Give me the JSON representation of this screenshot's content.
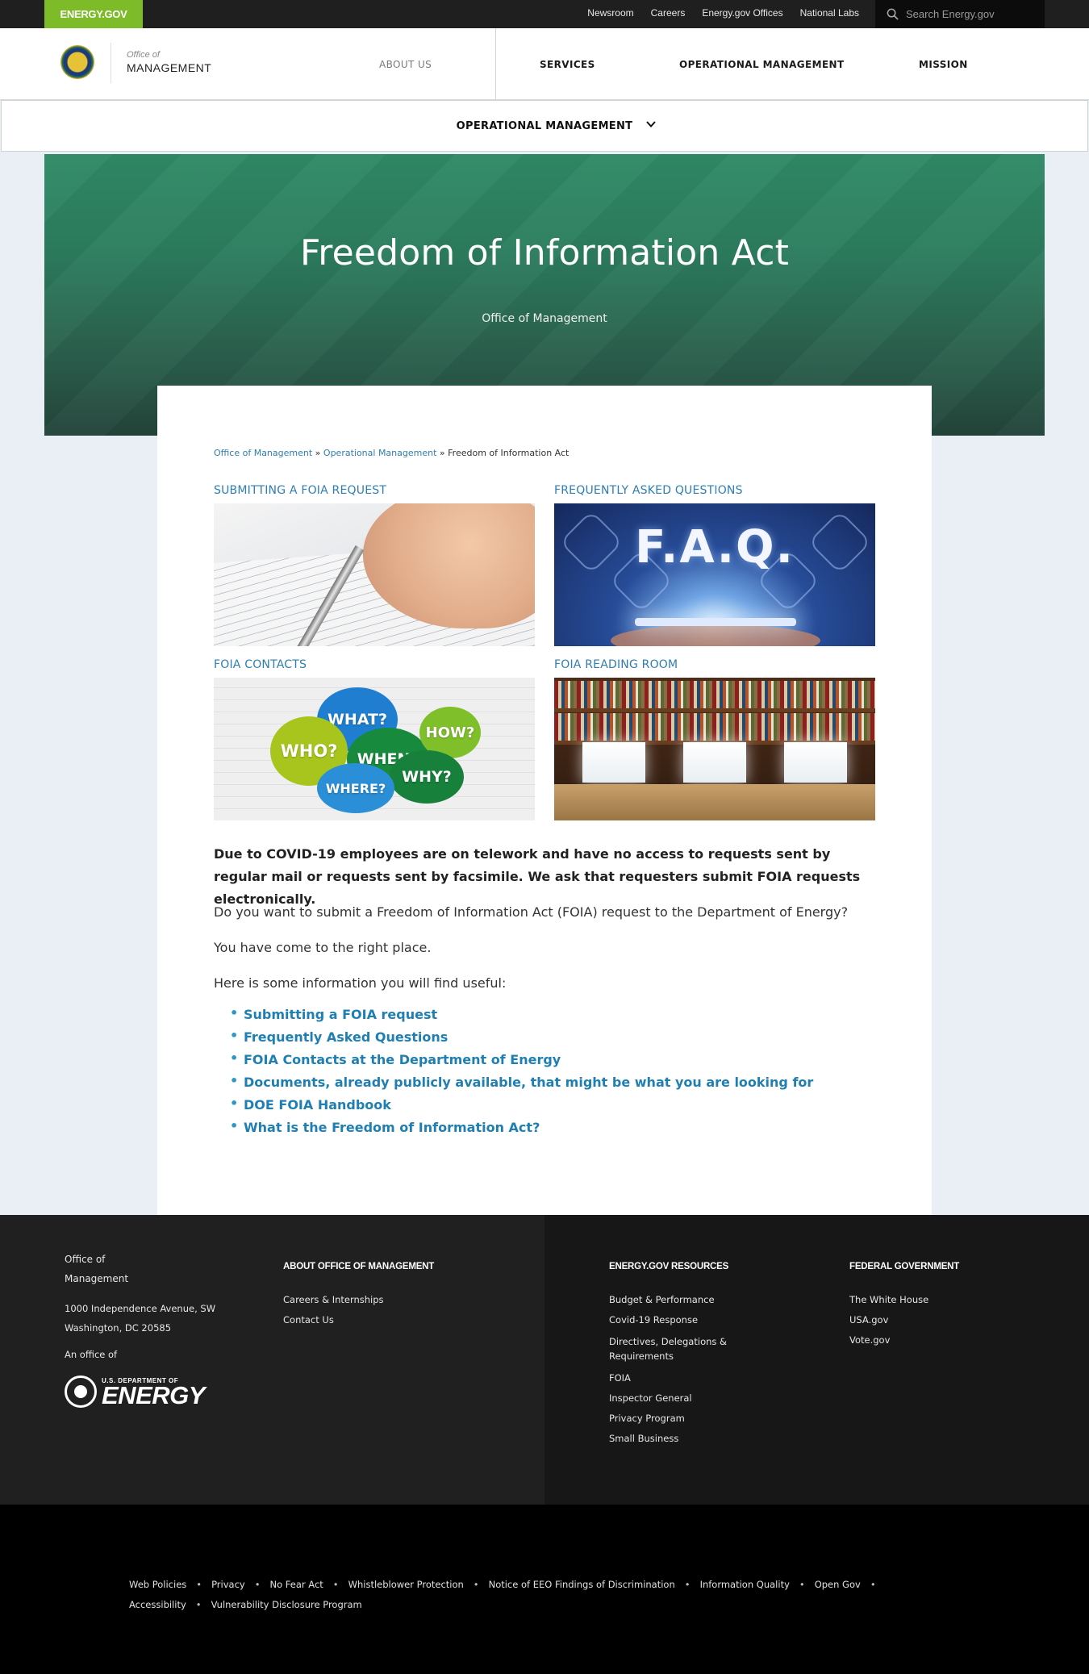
{
  "utility": {
    "badge": "ENERGY.GOV",
    "links": [
      "Newsroom",
      "Careers",
      "Energy.gov Offices",
      "National Labs"
    ],
    "search_placeholder": "Search Energy.gov"
  },
  "header": {
    "brand_small": "Office of",
    "brand_big": "MANAGEMENT",
    "nav": [
      "ABOUT US",
      "SERVICES",
      "OPERATIONAL MANAGEMENT",
      "MISSION"
    ]
  },
  "subnav": {
    "label": "OPERATIONAL MANAGEMENT"
  },
  "hero": {
    "title": "Freedom of Information Act",
    "subtitle": "Office of Management"
  },
  "breadcrumb": {
    "items": [
      "Office of Management",
      "Operational Management"
    ],
    "separator": "»",
    "current": "Freedom of Information Act"
  },
  "tiles": [
    {
      "title": "SUBMITTING A FOIA REQUEST"
    },
    {
      "title": "FREQUENTLY ASKED QUESTIONS",
      "image_text": "F.A.Q."
    },
    {
      "title": "FOIA CONTACTS",
      "image_words": [
        "WHAT?",
        "WHO?",
        "WHEN?",
        "HOW?",
        "WHY?",
        "WHERE?"
      ]
    },
    {
      "title": "FOIA READING ROOM"
    }
  ],
  "content": {
    "notice": "Due to COVID-19 employees are on telework and have no access to requests sent by regular mail or requests sent by facsimile.  We ask that requesters submit FOIA requests electronically.",
    "p1": "Do you want to submit a Freedom of Information Act (FOIA) request to the Department of Energy?",
    "p2": "You have come to the right place.",
    "p3": "Here is some information you will find useful:",
    "links": [
      "Submitting a FOIA request",
      "Frequently Asked Questions",
      "FOIA Contacts at the Department of Energy",
      "Documents, already publicly available, that might be what you are looking for",
      "DOE FOIA Handbook",
      "What is the Freedom of Information Act?"
    ]
  },
  "footer": {
    "office_line1": "Office of",
    "office_line2": "Management",
    "address_line1": "1000 Independence Avenue, SW",
    "address_line2": "Washington, DC 20585",
    "office_of": "An office of",
    "doe_small": "U.S. DEPARTMENT OF",
    "doe_big": "ENERGY",
    "about": {
      "heading": "ABOUT OFFICE OF MANAGEMENT",
      "links": [
        "Careers & Internships",
        "Contact Us"
      ]
    },
    "resources": {
      "heading": "ENERGY.GOV RESOURCES",
      "links": [
        "Budget & Performance",
        "Covid-19 Response",
        "Directives, Delegations & Requirements",
        "FOIA",
        "Inspector General",
        "Privacy Program",
        "Small Business"
      ]
    },
    "federal": {
      "heading": "FEDERAL GOVERNMENT",
      "links": [
        "The White House",
        "USA.gov",
        "Vote.gov"
      ]
    }
  },
  "bottom": {
    "row1": [
      "Web Policies",
      "Privacy",
      "No Fear Act",
      "Whistleblower Protection",
      "Notice of EEO Findings of Discrimination",
      "Information Quality",
      "Open Gov"
    ],
    "row2": [
      "Accessibility",
      "Vulnerability Disclosure Program"
    ]
  },
  "colors": {
    "accent_green": "#7dbb29",
    "link_blue": "#2f7eb1",
    "hero_green": "#2c7d5f"
  }
}
